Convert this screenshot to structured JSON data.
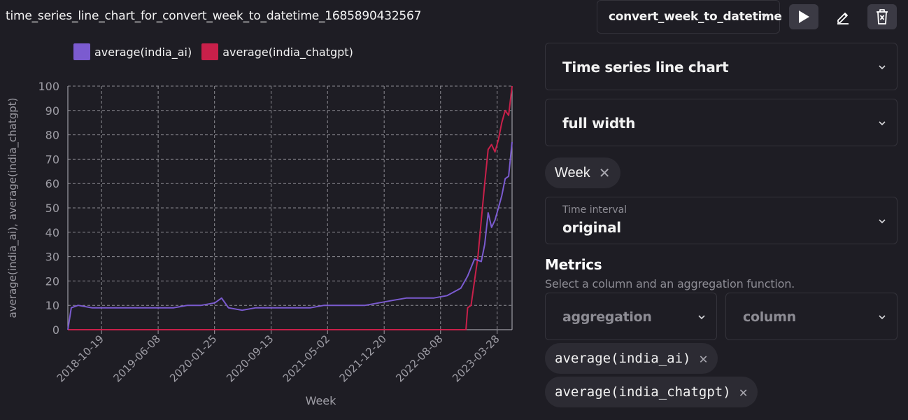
{
  "header": {
    "title": "time_series_line_chart_for_convert_week_to_datetime_1685890432567",
    "dataset_select": "convert_week_to_datetime"
  },
  "legend": [
    {
      "label": "average(india_ai)",
      "color": "#7b5bd0"
    },
    {
      "label": "average(india_chatgpt)",
      "color": "#c8204a"
    }
  ],
  "settings": {
    "chart_type": "Time series line chart",
    "width": "full width",
    "x_chip": "Week",
    "time_interval_label": "Time interval",
    "time_interval_value": "original",
    "metrics_title": "Metrics",
    "metrics_desc": "Select a column and an aggregation function.",
    "aggregation_placeholder": "aggregation",
    "column_placeholder": "column",
    "metric_chips": [
      "average(india_ai)",
      "average(india_chatgpt)"
    ]
  },
  "colors": {
    "background": "#1e1d24",
    "ai_series": "#7b5bd0",
    "chatgpt_series": "#c8204a",
    "grid": "#8c8b92"
  },
  "chart_data": {
    "type": "line",
    "xlabel": "Week",
    "ylabel": "average(india_ai), average(india_chatgpt)",
    "ylim": [
      0,
      100
    ],
    "yticks": [
      0,
      10,
      20,
      30,
      40,
      50,
      60,
      70,
      80,
      90,
      100
    ],
    "xlim": [
      "2018-06-03",
      "2023-05-28"
    ],
    "xticks": [
      "2018-10-19",
      "2019-06-08",
      "2020-01-25",
      "2020-09-13",
      "2021-05-02",
      "2021-12-20",
      "2022-08-08",
      "2023-03-28"
    ],
    "grid": true,
    "legend_position": "top-left",
    "series": [
      {
        "name": "average(india_ai)",
        "x": [
          "2018-06-03",
          "2018-06-17",
          "2018-07-15",
          "2018-09-09",
          "2018-11-04",
          "2018-12-30",
          "2019-02-24",
          "2019-04-21",
          "2019-06-16",
          "2019-08-11",
          "2019-10-06",
          "2019-12-01",
          "2020-01-26",
          "2020-02-23",
          "2020-03-22",
          "2020-05-17",
          "2020-07-12",
          "2020-09-06",
          "2020-11-01",
          "2020-12-27",
          "2021-02-21",
          "2021-04-18",
          "2021-06-13",
          "2021-08-08",
          "2021-10-03",
          "2021-11-28",
          "2022-01-23",
          "2022-03-20",
          "2022-05-15",
          "2022-07-10",
          "2022-09-04",
          "2022-10-30",
          "2022-11-27",
          "2022-12-25",
          "2023-01-22",
          "2023-02-05",
          "2023-02-19",
          "2023-03-05",
          "2023-03-19",
          "2023-04-02",
          "2023-04-16",
          "2023-04-30",
          "2023-05-14",
          "2023-05-28"
        ],
        "y": [
          0,
          9,
          10,
          9,
          9,
          9,
          9,
          9,
          9,
          9,
          10,
          10,
          11,
          13,
          9,
          8,
          9,
          9,
          9,
          9,
          9,
          10,
          10,
          10,
          10,
          11,
          12,
          13,
          13,
          13,
          14,
          17,
          22,
          29,
          28,
          35,
          48,
          42,
          45,
          50,
          55,
          62,
          63,
          77
        ]
      },
      {
        "name": "average(india_chatgpt)",
        "x": [
          "2018-06-03",
          "2022-11-20",
          "2022-11-27",
          "2022-12-11",
          "2022-12-25",
          "2023-01-08",
          "2023-01-22",
          "2023-02-05",
          "2023-02-19",
          "2023-03-05",
          "2023-03-19",
          "2023-04-02",
          "2023-04-16",
          "2023-04-30",
          "2023-05-14",
          "2023-05-28"
        ],
        "y": [
          0,
          0,
          9,
          10,
          20,
          30,
          45,
          60,
          74,
          76,
          73,
          78,
          85,
          90,
          88,
          100
        ]
      }
    ]
  }
}
